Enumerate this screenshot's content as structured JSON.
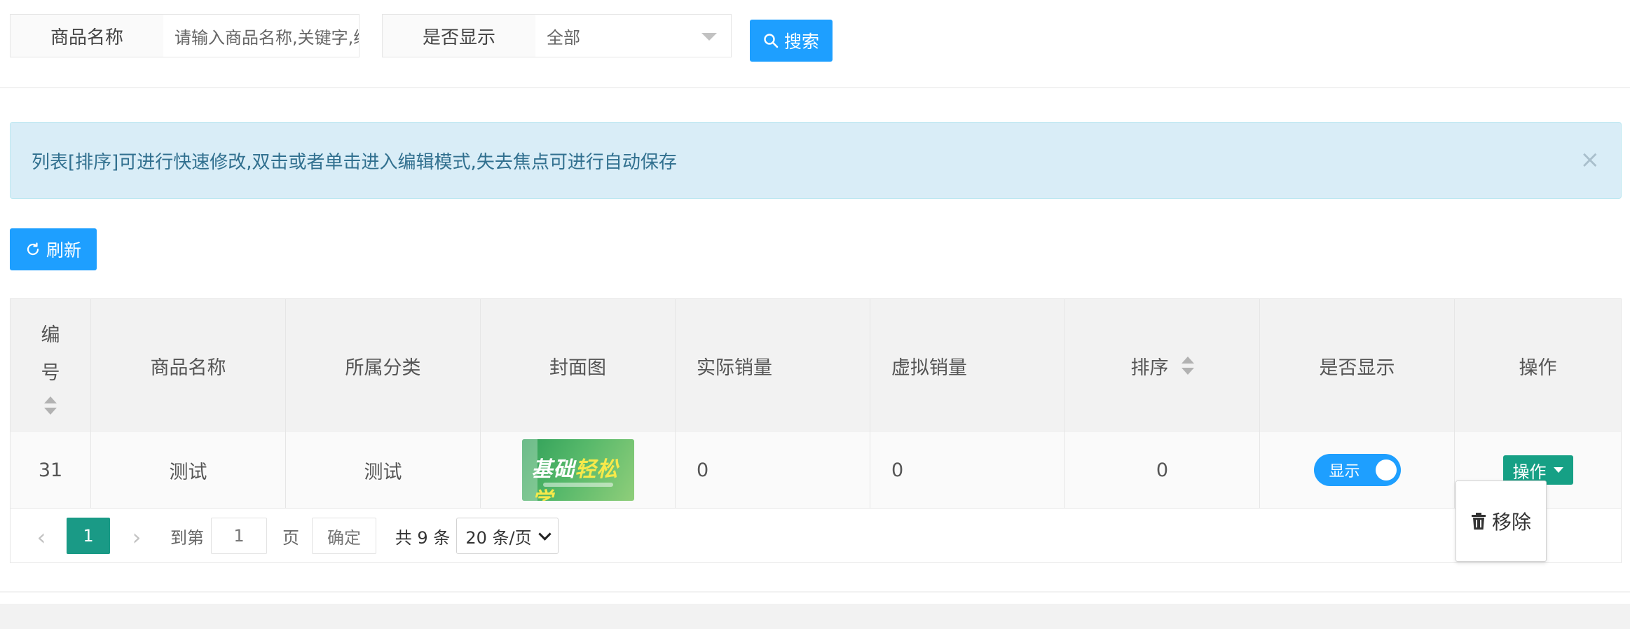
{
  "search": {
    "name_label": "商品名称",
    "name_placeholder": "请输入商品名称,关键字,编号",
    "display_label": "是否显示",
    "display_value": "全部",
    "search_button": "搜索"
  },
  "alert": {
    "message": "列表[排序]可进行快速修改,双击或者单击进入编辑模式,失去焦点可进行自动保存",
    "close": "×"
  },
  "toolbar": {
    "refresh_label": "刷新"
  },
  "table": {
    "headers": {
      "id_line1": "编",
      "id_line2": "号",
      "name": "商品名称",
      "category": "所属分类",
      "cover": "封面图",
      "actual_sales": "实际销量",
      "virtual_sales": "虚拟销量",
      "sort": "排序",
      "display": "是否显示",
      "ops": "操作"
    },
    "rows": [
      {
        "id": "31",
        "name": "测试",
        "category": "测试",
        "actual_sales": "0",
        "virtual_sales": "0",
        "sort": "0",
        "display_label": "显示",
        "display_on": true,
        "ops_label": "操作"
      }
    ]
  },
  "pagination": {
    "prev": "‹",
    "current_page": "1",
    "next": "›",
    "goto_label": "到第",
    "goto_value": "1",
    "page_unit": "页",
    "confirm": "确定",
    "total": "共 9 条",
    "page_size": "20 条/页"
  },
  "dropdown": {
    "remove_label": "移除"
  },
  "colors": {
    "primary": "#1e9fff",
    "teal": "#16a085",
    "pager_active": "#1a9a86",
    "alert_bg": "#d9edf7",
    "alert_text": "#31708f"
  }
}
